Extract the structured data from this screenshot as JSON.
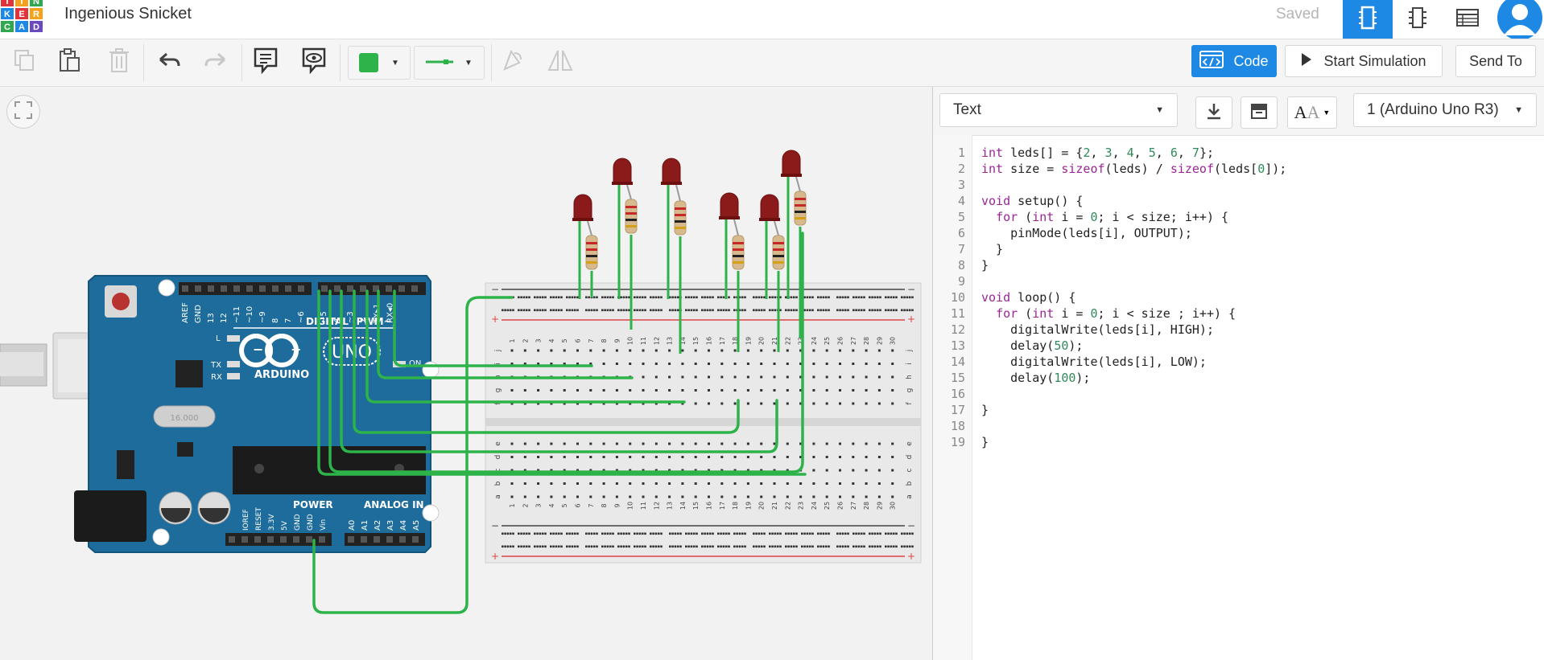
{
  "app": {
    "title": "Ingenious Snicket",
    "save_status": "Saved",
    "logo_letters": [
      "T",
      "I",
      "N",
      "K",
      "E",
      "R",
      "C",
      "A",
      "D"
    ]
  },
  "views": [
    {
      "name": "circuit-view",
      "active": true
    },
    {
      "name": "schematic-view",
      "active": false
    },
    {
      "name": "component-list-view",
      "active": false
    }
  ],
  "toolbar": {
    "code_label": "Code",
    "start_sim_label": "Start Simulation",
    "send_to_label": "Send To",
    "wire_color": "#2db34a"
  },
  "code_panel": {
    "mode": "Text",
    "device": "1 (Arduino Uno R3)",
    "lines": [
      "int leds[] = {2, 3, 4, 5, 6, 7};",
      "int size = sizeof(leds) / sizeof(leds[0]);",
      "",
      "void setup() {",
      "  for (int i = 0; i < size; i++) {",
      "    pinMode(leds[i], OUTPUT);",
      "  }",
      "}",
      "",
      "void loop() {",
      "  for (int i = 0; i < size ; i++) {",
      "    digitalWrite(leds[i], HIGH);",
      "    delay(50);",
      "    digitalWrite(leds[i], LOW);",
      "    delay(100);",
      "",
      "}",
      "",
      "}"
    ]
  },
  "board": {
    "brand": "ARDUINO",
    "model": "UNO",
    "digital_label": "DIGITAL (PWM~)",
    "power_label": "POWER",
    "analog_label": "ANALOG IN",
    "on_label": "ON",
    "l_label": "L",
    "tx_label": "TX",
    "rx_label": "RX",
    "crystal_label": "16.000",
    "top_pins": [
      "AREF",
      "GND",
      "13",
      "12",
      "~11",
      "~10",
      "~9",
      "8",
      "7",
      "~6",
      "~5",
      "4",
      "~3",
      "2",
      "TX▸1",
      "RX◂0"
    ],
    "power_pins": [
      "IOREF",
      "RESET",
      "3.3V",
      "5V",
      "GND",
      "GND",
      "Vin"
    ],
    "analog_pins": [
      "A0",
      "A1",
      "A2",
      "A3",
      "A4",
      "A5"
    ]
  },
  "breadboard": {
    "top_letters": [
      "j",
      "i",
      "h",
      "g",
      "f"
    ],
    "bottom_letters": [
      "e",
      "d",
      "c",
      "b",
      "a"
    ],
    "columns": [
      "1",
      "2",
      "3",
      "4",
      "5",
      "6",
      "7",
      "8",
      "9",
      "10",
      "11",
      "12",
      "13",
      "14",
      "15",
      "16",
      "17",
      "18",
      "19",
      "20",
      "21",
      "22",
      "23",
      "24",
      "25",
      "26",
      "27",
      "28",
      "29",
      "30"
    ],
    "rail_minus": "−",
    "rail_plus": "+"
  }
}
